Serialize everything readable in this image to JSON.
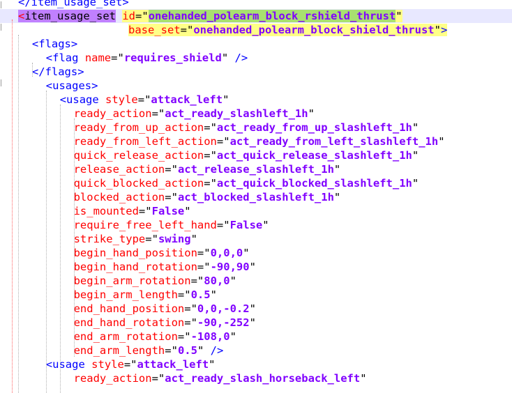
{
  "editor": {
    "lines": [
      {
        "indent": 1,
        "html": "<span class=\"tk-bracket\">&lt;/</span><span class=\"tk-tag\">item_usage_set</span><span class=\"tk-bracket\">&gt;</span>",
        "text": "</item_usage_set>"
      },
      {
        "indent": 1,
        "special": "open_item_usage_set",
        "tag": "item_usage_set",
        "attr_id": "id",
        "val_id": "onehanded_polearm_block_rshield_thrust"
      },
      {
        "indent": 1,
        "special": "base_set",
        "attr": "base_set",
        "val": "onehanded_polearm_block_shield_thrust"
      },
      {
        "indent": 2,
        "text": "<flags>"
      },
      {
        "indent": 3,
        "text": "<flag name=\"requires_shield\" />"
      },
      {
        "indent": 2,
        "text": "</flags>"
      },
      {
        "indent": 3,
        "text": "<usages>"
      },
      {
        "indent": 4,
        "text": "<usage style=\"attack_left\""
      },
      {
        "indent": 5,
        "text": "ready_action=\"act_ready_slashleft_1h\""
      },
      {
        "indent": 5,
        "text": "ready_from_up_action=\"act_ready_from_up_slashleft_1h\""
      },
      {
        "indent": 5,
        "text": "ready_from_left_action=\"act_ready_from_left_slashleft_1h\""
      },
      {
        "indent": 5,
        "text": "quick_release_action=\"act_quick_release_slashleft_1h\""
      },
      {
        "indent": 5,
        "text": "release_action=\"act_release_slashleft_1h\""
      },
      {
        "indent": 5,
        "text": "quick_blocked_action=\"act_quick_blocked_slashleft_1h\""
      },
      {
        "indent": 5,
        "text": "blocked_action=\"act_blocked_slashleft_1h\""
      },
      {
        "indent": 5,
        "text": "is_mounted=\"False\""
      },
      {
        "indent": 5,
        "text": "require_free_left_hand=\"False\""
      },
      {
        "indent": 5,
        "text": "strike_type=\"swing\""
      },
      {
        "indent": 5,
        "text": "begin_hand_position=\"0,0,0\""
      },
      {
        "indent": 5,
        "text": "begin_hand_rotation=\"-90,90\""
      },
      {
        "indent": 5,
        "text": "begin_arm_rotation=\"80,0\""
      },
      {
        "indent": 5,
        "text": "begin_arm_length=\"0.5\""
      },
      {
        "indent": 5,
        "text": "end_hand_position=\"0,0,-0.2\""
      },
      {
        "indent": 5,
        "text": "end_hand_rotation=\"-90,-252\""
      },
      {
        "indent": 5,
        "text": "end_arm_rotation=\"-108,0\""
      },
      {
        "indent": 5,
        "text": "end_arm_length=\"0.5\" />"
      },
      {
        "indent": 3,
        "text": "<usage style=\"attack_left\""
      },
      {
        "indent": 5,
        "text": "ready_action=\"act_ready_slash_horseback_left\""
      }
    ]
  },
  "colors": {
    "tag": "#0000ff",
    "attribute": "#ff0000",
    "value": "#8000ff",
    "current_line": "#e8e8ff",
    "tag_match": "#c080ff",
    "selection": "#a8e070",
    "highlight": "#ffff88"
  }
}
